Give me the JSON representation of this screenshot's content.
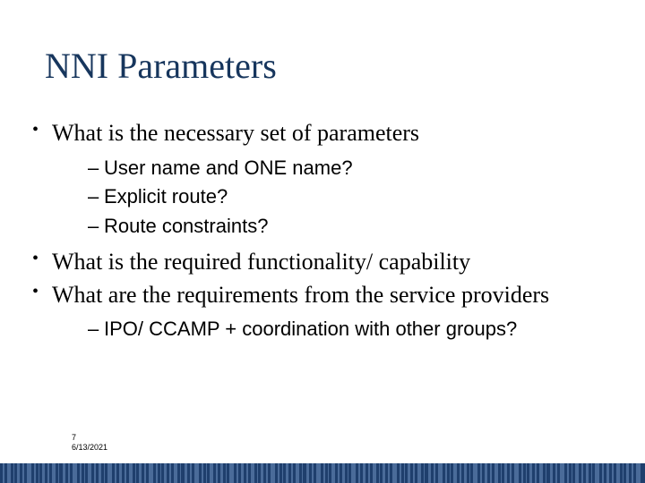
{
  "title": "NNI Parameters",
  "bullets": [
    {
      "text": "What is the necessary set of parameters",
      "sub": [
        "User name and ONE name?",
        "Explicit route?",
        "Route constraints?"
      ]
    },
    {
      "text": "What is the required functionality/ capability",
      "sub": []
    },
    {
      "text": "What are the requirements from the service providers",
      "sub": [
        "IPO/ CCAMP + coordination with other groups?"
      ]
    }
  ],
  "footer": {
    "page": "7",
    "date": "6/13/2021"
  }
}
